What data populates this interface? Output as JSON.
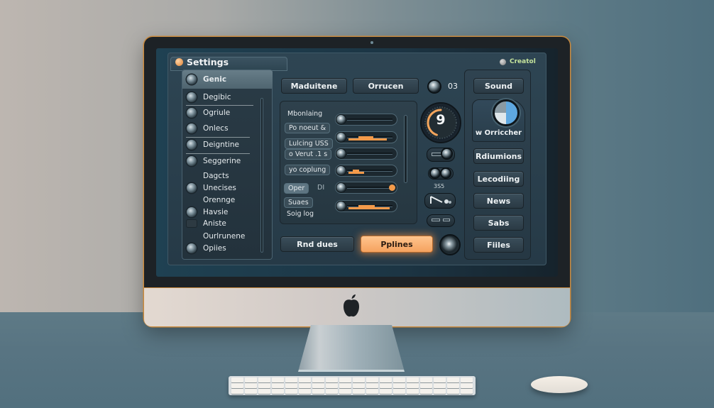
{
  "window": {
    "title": "Settings",
    "creator_label": "Creatol"
  },
  "sidebar": {
    "items": [
      {
        "label": "Genic",
        "active": true,
        "has_knob": true
      },
      {
        "label": "Degibic",
        "has_knob": true
      },
      {
        "label": "Ogriule",
        "has_knob": true
      },
      {
        "label": "Onlecs",
        "has_knob": true
      },
      {
        "label": "Deigntine",
        "has_knob": true
      },
      {
        "label": "Seggerine",
        "has_knob": true
      },
      {
        "label": "Dagcts",
        "has_knob": false
      },
      {
        "label": "Unecises",
        "has_knob": true
      },
      {
        "label": "Orennge",
        "has_knob": false
      },
      {
        "label": "Havsie",
        "has_knob": true
      },
      {
        "label": "Aniste",
        "has_knob": "flat"
      },
      {
        "label": "Ourlrunene",
        "has_knob": false
      },
      {
        "label": "Opiies",
        "has_knob": true
      }
    ]
  },
  "toolbar": {
    "buttons": [
      "Maduitene",
      "Orrucen"
    ],
    "counter_value": "03"
  },
  "controls": {
    "labels": [
      "Mbonlaing",
      "Po noeut &",
      "Lulcing USS",
      "o Verut .1 s",
      "yo coplung",
      "Oper",
      "DI",
      "Suaes",
      "Soig log"
    ],
    "sliders": [
      {
        "name": "slider-1",
        "value": 0.0
      },
      {
        "name": "slider-2",
        "value": 0.85
      },
      {
        "name": "slider-3",
        "value": 0.0
      },
      {
        "name": "slider-4",
        "value": 0.35
      },
      {
        "name": "slider-5",
        "value": 1.0
      },
      {
        "name": "slider-6",
        "value": 0.9
      }
    ]
  },
  "tools": {
    "dial_value": "9",
    "dial_progress": 0.45,
    "mini_label": "3S5"
  },
  "right_panel": {
    "buttons": [
      "Sound",
      "Rdiumions",
      "Lecodiing",
      "News",
      "Sabs",
      "Fiiles"
    ],
    "wheel_label": "w Orriccher"
  },
  "footer": {
    "left_button": "Rnd dues",
    "primary_button": "Pplines"
  },
  "colors": {
    "accent": "#f5a25f",
    "panel": "#2e4553",
    "text": "#eef2f4"
  }
}
